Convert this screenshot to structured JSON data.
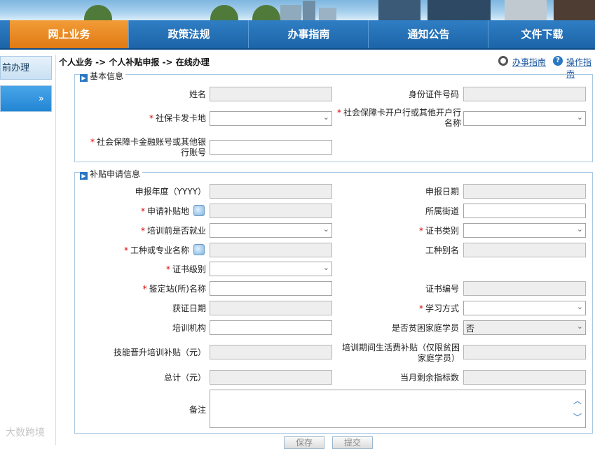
{
  "nav": [
    {
      "label": "网上业务"
    },
    {
      "label": "政策法规"
    },
    {
      "label": "办事指南"
    },
    {
      "label": "通知公告"
    },
    {
      "label": "文件下载"
    }
  ],
  "sidebar": [
    {
      "label": "前办理"
    },
    {
      "label": "»"
    }
  ],
  "breadcrumb": "个人业务 -> 个人补贴申报 -> 在线办理",
  "help_links": {
    "guide": "办事指南",
    "operation": "操作指南"
  },
  "basic": {
    "title": "基本信息",
    "name": "姓名",
    "id_number": "身份证件号码",
    "card_issue_place": "社保卡发卡地",
    "bank_name": "社会保障卡开户行或其他开户行名称",
    "account": "社会保障卡金融账号或其他银行账号"
  },
  "subsidy": {
    "title": "补贴申请信息",
    "year": "申报年度（YYYY）",
    "date": "申报日期",
    "place": "申请补贴地",
    "street": "所属街道",
    "employed": "培训前是否就业",
    "cert_type": "证书类别",
    "trade": "工种或专业名称",
    "trade_alias": "工种别名",
    "cert_level": "证书级别",
    "station": "鉴定站(所)名称",
    "cert_no": "证书编号",
    "cert_date": "获证日期",
    "study_mode": "学习方式",
    "institution": "培训机构",
    "poor_family": "是否贫困家庭学员",
    "poor_family_value": "否",
    "skill_subsidy": "技能晋升培训补贴（元）",
    "living_subsidy": "培训期间生活费补贴（仅限贫困家庭学员）",
    "total": "总计（元）",
    "remaining": "当月剩余指标数",
    "remark": "备注"
  },
  "buttons": {
    "save": "保存",
    "submit": "提交"
  },
  "watermark": "大数跨境"
}
